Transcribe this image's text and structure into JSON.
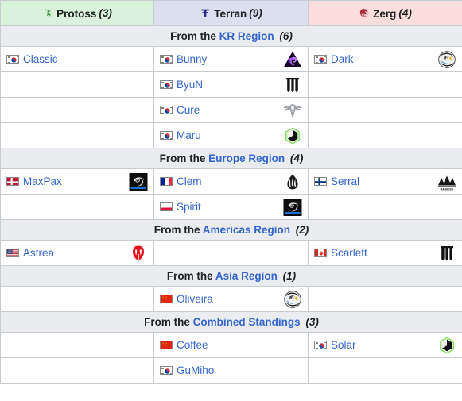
{
  "header": {
    "columns": [
      {
        "race": "Protoss",
        "count": "(3)",
        "icon": "protoss-icon",
        "bg": "#d9f2db"
      },
      {
        "race": "Terran",
        "count": "(9)",
        "icon": "terran-icon",
        "bg": "#dce0ee"
      },
      {
        "race": "Zerg",
        "count": "(4)",
        "icon": "zerg-icon",
        "bg": "#fadede"
      }
    ]
  },
  "colors": {
    "link": "#3366cc",
    "region_bg": "#eaecf0",
    "border": "#c8ccd1",
    "protoss": "#2a8a3e",
    "terran": "#2a2a8a",
    "zerg": "#a52a3a"
  },
  "sections": [
    {
      "prefix": "From the",
      "region": "KR Region",
      "count": "(6)",
      "rows": [
        {
          "protoss": {
            "name": "Classic",
            "flag": "kr",
            "team": null
          },
          "terran": {
            "name": "Bunny",
            "flag": "kr",
            "team": "dkz-triangle-logo"
          },
          "zerg": {
            "name": "Dark",
            "flag": "kr",
            "team": "dragon-phoenix-logo"
          }
        },
        {
          "protoss": null,
          "terran": {
            "name": "ByuN",
            "flag": "kr",
            "team": "crown-pillars-logo"
          },
          "zerg": null
        },
        {
          "protoss": null,
          "terran": {
            "name": "Cure",
            "flag": "kr",
            "team": "winged-emblem-logo"
          },
          "zerg": null
        },
        {
          "protoss": null,
          "terran": {
            "name": "Maru",
            "flag": "kr",
            "team": "green-hex-logo"
          },
          "zerg": null
        }
      ]
    },
    {
      "prefix": "From the",
      "region": "Europe Region",
      "count": "(4)",
      "rows": [
        {
          "protoss": {
            "name": "MaxPax",
            "flag": "dk",
            "team": "shopify-rebellion-logo"
          },
          "terran": {
            "name": "Clem",
            "flag": "fr",
            "team": "team-liquid-logo"
          },
          "zerg": {
            "name": "Serral",
            "flag": "fi",
            "team": "basilisk-logo"
          }
        },
        {
          "protoss": null,
          "terran": {
            "name": "Spirit",
            "flag": "pl",
            "team": "shopify-rebellion-logo"
          },
          "zerg": null
        }
      ]
    },
    {
      "prefix": "From the",
      "region": "Americas Region",
      "count": "(2)",
      "rows": [
        {
          "protoss": {
            "name": "Astrea",
            "flag": "us",
            "team": "red-helmet-logo"
          },
          "terran": null,
          "zerg": {
            "name": "Scarlett",
            "flag": "ca",
            "team": "crown-pillars-logo"
          }
        }
      ]
    },
    {
      "prefix": "From the",
      "region": "Asia Region",
      "count": "(1)",
      "rows": [
        {
          "protoss": null,
          "terran": {
            "name": "Oliveira",
            "flag": "cn",
            "team": "dragon-phoenix-logo"
          },
          "zerg": null
        }
      ]
    },
    {
      "prefix": "From the",
      "region": "Combined Standings",
      "count": "(3)",
      "rows": [
        {
          "protoss": null,
          "terran": {
            "name": "Coffee",
            "flag": "cn",
            "team": null
          },
          "zerg": {
            "name": "Solar",
            "flag": "kr",
            "team": "green-hex-logo"
          }
        },
        {
          "protoss": null,
          "terran": {
            "name": "GuMiho",
            "flag": "kr",
            "team": null
          },
          "zerg": null
        }
      ]
    }
  ]
}
